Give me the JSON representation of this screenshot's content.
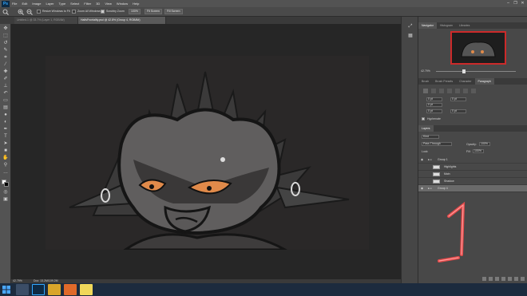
{
  "app": {
    "logo": "Ps"
  },
  "menu": [
    "File",
    "Edit",
    "Image",
    "Layer",
    "Type",
    "Select",
    "Filter",
    "3D",
    "View",
    "Window",
    "Help"
  ],
  "window_controls": {
    "minimize": "–",
    "restore": "❐",
    "close": "✕"
  },
  "options": {
    "resize_windows_label": "Resize Windows to Fit",
    "zoom_all_label": "Zoom All Windows",
    "scrubby_zoom_label": "Scrubby Zoom",
    "zoom_100": "100%",
    "fit_screen": "Fit Screen",
    "fill_screen": "Fill Screen"
  },
  "doc_tabs": [
    "Untitled-1 @ 33.7% (Layer 1, RGB/8#)",
    "HalfsFrontality.psd @ 42.8% (Group 4, RGB/8#)"
  ],
  "tools": [
    "move-icon",
    "marquee-icon",
    "lasso-icon",
    "quick-select-icon",
    "crop-icon",
    "eyedropper-icon",
    "healing-icon",
    "brush-icon",
    "stamp-icon",
    "history-brush-icon",
    "eraser-icon",
    "gradient-icon",
    "blur-icon",
    "dodge-icon",
    "pen-icon",
    "type-icon",
    "path-select-icon",
    "shape-icon",
    "hand-icon",
    "zoom-icon",
    "more-icon"
  ],
  "status": {
    "zoom": "42.79%",
    "doc_size": "Doc: 13.2M/109.2M"
  },
  "navigator": {
    "tabs": [
      "Navigator",
      "Histogram",
      "Libraries"
    ],
    "zoom": "42.79%"
  },
  "type_panel": {
    "tabs": [
      "Brush",
      "Brush Presets",
      "Character",
      "Paragraph"
    ],
    "fields": [
      "0 pt",
      "0 pt",
      "0 pt",
      "0 pt",
      "0 pt"
    ],
    "hyphenate": "Hyphenate"
  },
  "layers": {
    "title": "Layers",
    "kind": "Kind",
    "blend": "Pass Through",
    "opacity_label": "Opacity:",
    "opacity": "100%",
    "lock_label": "Lock:",
    "fill_label": "Fill:",
    "fill": "100%",
    "rows": [
      {
        "name": "Group 1",
        "group": true
      },
      {
        "name": "Highlights"
      },
      {
        "name": "Main"
      },
      {
        "name": "Shadow"
      },
      {
        "name": "Group 4",
        "group": true,
        "selected": true
      }
    ]
  },
  "annotation": {
    "text": "1",
    "color": "#e24a4a"
  },
  "taskbar": {
    "time": "",
    "apps": [
      "file-explorer",
      "photoshop",
      "chrome",
      "firefox",
      "sticky-notes"
    ]
  },
  "colors": {
    "accent": "#31a8ff",
    "nav_border": "#cc2a2a"
  }
}
